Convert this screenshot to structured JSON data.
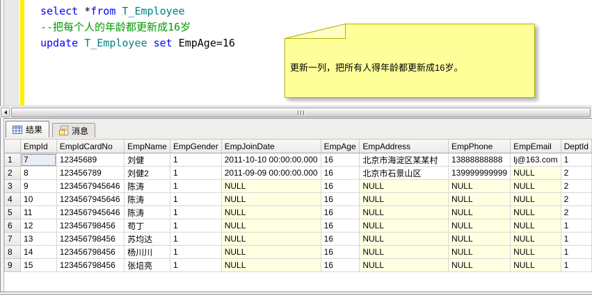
{
  "editor": {
    "code_lines": [
      [
        {
          "text": "select",
          "type": "keyword"
        },
        {
          "text": " *",
          "type": "plain"
        },
        {
          "text": "from",
          "type": "keyword"
        },
        {
          "text": " ",
          "type": "plain"
        },
        {
          "text": "T_Employee",
          "type": "object"
        }
      ],
      [
        {
          "text": "--把每个人的年龄都更新成16岁",
          "type": "comment"
        }
      ],
      [
        {
          "text": "update",
          "type": "keyword"
        },
        {
          "text": " ",
          "type": "plain"
        },
        {
          "text": "T_Employee",
          "type": "object"
        },
        {
          "text": " ",
          "type": "plain"
        },
        {
          "text": "set",
          "type": "keyword"
        },
        {
          "text": " EmpAge=16",
          "type": "plain"
        }
      ]
    ]
  },
  "note": {
    "text": "更新一列，把所有人得年龄都更新成16岁。"
  },
  "results": {
    "tabs": [
      {
        "label": "结果",
        "icon": "results-grid-icon"
      },
      {
        "label": "消息",
        "icon": "messages-icon"
      }
    ],
    "columns": [
      "EmpId",
      "EmpIdCardNo",
      "EmpName",
      "EmpGender",
      "EmpJoinDate",
      "EmpAge",
      "EmpAddress",
      "EmpPhone",
      "EmpEmail",
      "DeptId"
    ],
    "rows": [
      {
        "num": "1",
        "cells": [
          "7",
          "12345689",
          "刘健",
          "1",
          "2011-10-10 00:00:00.000",
          "16",
          "北京市海淀区某某村",
          "13888888888",
          "lj@163.com",
          "1"
        ]
      },
      {
        "num": "2",
        "cells": [
          "8",
          "123456789",
          "刘健2",
          "1",
          "2011-09-09 00:00:00.000",
          "16",
          "北京市石景山区",
          "139999999999",
          "NULL",
          "2"
        ]
      },
      {
        "num": "3",
        "cells": [
          "9",
          "1234567945646",
          "陈涛",
          "1",
          "NULL",
          "16",
          "NULL",
          "NULL",
          "NULL",
          "2"
        ]
      },
      {
        "num": "4",
        "cells": [
          "10",
          "1234567945646",
          "陈涛",
          "1",
          "NULL",
          "16",
          "NULL",
          "NULL",
          "NULL",
          "2"
        ]
      },
      {
        "num": "5",
        "cells": [
          "11",
          "1234567945646",
          "陈涛",
          "1",
          "NULL",
          "16",
          "NULL",
          "NULL",
          "NULL",
          "2"
        ]
      },
      {
        "num": "6",
        "cells": [
          "12",
          "123456798456",
          "苟丁",
          "1",
          "NULL",
          "16",
          "NULL",
          "NULL",
          "NULL",
          "1"
        ]
      },
      {
        "num": "7",
        "cells": [
          "13",
          "123456798456",
          "苏均达",
          "1",
          "NULL",
          "16",
          "NULL",
          "NULL",
          "NULL",
          "1"
        ]
      },
      {
        "num": "8",
        "cells": [
          "14",
          "123456798456",
          "杨川川",
          "1",
          "NULL",
          "16",
          "NULL",
          "NULL",
          "NULL",
          "1"
        ]
      },
      {
        "num": "9",
        "cells": [
          "15",
          "123456798456",
          "张培亮",
          "1",
          "NULL",
          "16",
          "NULL",
          "NULL",
          "NULL",
          "1"
        ]
      }
    ],
    "selected_cell": {
      "row": 0,
      "col": 0,
      "value": "7"
    }
  },
  "colors": {
    "kw": "#0000ff",
    "obj": "#008080",
    "cmt": "#009900",
    "plain": "#000000",
    "changebar": "#fdf000",
    "note_fill": "#ffff99",
    "note_fold": "#ffffc2",
    "note_border": "#b2b200",
    "null_bg": "#ffffe1",
    "sel_bg": "#e8edf6"
  }
}
